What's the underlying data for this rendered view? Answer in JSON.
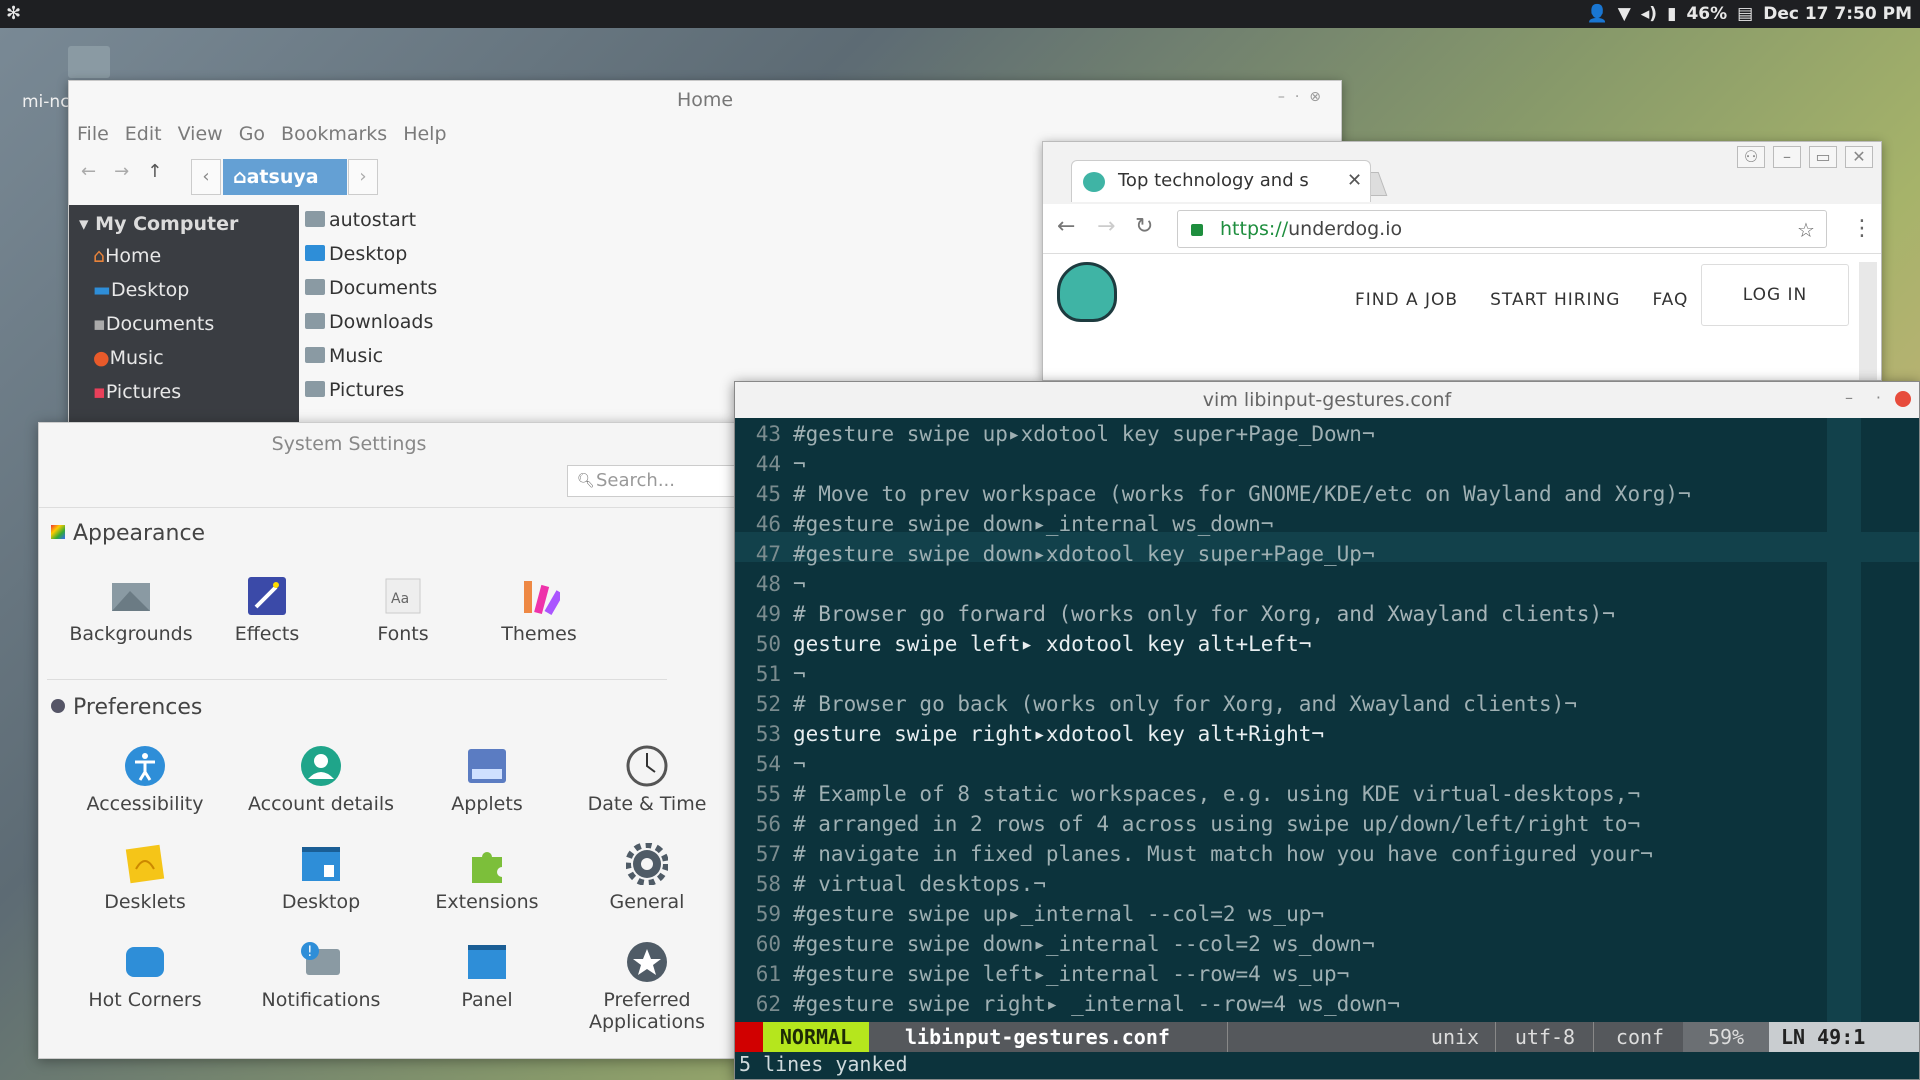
{
  "top_panel": {
    "menu_icon": "gear-icon",
    "battery": "46%",
    "datetime": "Dec 17  7:50 PM"
  },
  "desktop": {
    "folder_label": "mi-nc"
  },
  "file_manager": {
    "title": "Home",
    "menu": [
      "File",
      "Edit",
      "View",
      "Go",
      "Bookmarks",
      "Help"
    ],
    "breadcrumb": "atsuya",
    "sidebar_header": "My Computer",
    "sidebar": [
      "Home",
      "Desktop",
      "Documents",
      "Music",
      "Pictures"
    ],
    "files": [
      "autostart",
      "Desktop",
      "Documents",
      "Downloads",
      "Music",
      "Pictures"
    ]
  },
  "browser": {
    "tab_title": "Top technology and s",
    "url_scheme": "https://",
    "url_host": "underdog.io",
    "nav_links": [
      "FIND A JOB",
      "START HIRING",
      "FAQ"
    ],
    "login": "LOG IN"
  },
  "settings": {
    "title": "System Settings",
    "search_placeholder": "Search...",
    "appearance_title": "Appearance",
    "appearance": [
      "Backgrounds",
      "Effects",
      "Fonts",
      "Themes"
    ],
    "preferences_title": "Preferences",
    "preferences": [
      "Accessibility",
      "Account details",
      "Applets",
      "Date & Time",
      "Desklets",
      "Desktop",
      "Extensions",
      "General",
      "Hot Corners",
      "Notifications",
      "Panel",
      "Preferred Applications"
    ],
    "accent_blue": "#2e8ed8",
    "accent_teal": "#1fa58a"
  },
  "vim": {
    "title": "vim libinput-gestures.conf",
    "lines": [
      {
        "n": "43",
        "t": "#gesture swipe up▸xdotool key super+Page_Down¬"
      },
      {
        "n": "44",
        "t": "¬"
      },
      {
        "n": "45",
        "t": "# Move to prev workspace (works for GNOME/KDE/etc on Wayland and Xorg)¬"
      },
      {
        "n": "46",
        "t": "#gesture swipe down▸_internal ws_down¬"
      },
      {
        "n": "47",
        "t": "#gesture swipe down▸xdotool key super+Page_Up¬"
      },
      {
        "n": "48",
        "t": "¬"
      },
      {
        "n": "49",
        "t": "# Browser go forward (works only for Xorg, and Xwayland clients)¬"
      },
      {
        "n": "50",
        "t": "gesture swipe left▸ xdotool key alt+Left¬"
      },
      {
        "n": "51",
        "t": "¬"
      },
      {
        "n": "52",
        "t": "# Browser go back (works only for Xorg, and Xwayland clients)¬"
      },
      {
        "n": "53",
        "t": "gesture swipe right▸xdotool key alt+Right¬"
      },
      {
        "n": "54",
        "t": "¬"
      },
      {
        "n": "55",
        "t": "# Example of 8 static workspaces, e.g. using KDE virtual-desktops,¬"
      },
      {
        "n": "56",
        "t": "# arranged in 2 rows of 4 across using swipe up/down/left/right to¬"
      },
      {
        "n": "57",
        "t": "# navigate in fixed planes. Must match how you have configured your¬"
      },
      {
        "n": "58",
        "t": "# virtual desktops.¬"
      },
      {
        "n": "59",
        "t": "#gesture swipe up▸_internal --col=2 ws_up¬"
      },
      {
        "n": "60",
        "t": "#gesture swipe down▸_internal --col=2 ws_down¬"
      },
      {
        "n": "61",
        "t": "#gesture swipe left▸_internal --row=4 ws_up¬"
      },
      {
        "n": "62",
        "t": "#gesture swipe right▸ _internal --row=4 ws_down¬"
      }
    ],
    "mode": "NORMAL",
    "filename": "libinput-gestures.conf",
    "fileformat": "unix",
    "encoding": "utf-8",
    "filetype": "conf",
    "percent": "59%",
    "ln_label": "LN",
    "position": "49:1",
    "message": "5 lines yanked",
    "mode_color": "#b5e61d"
  }
}
